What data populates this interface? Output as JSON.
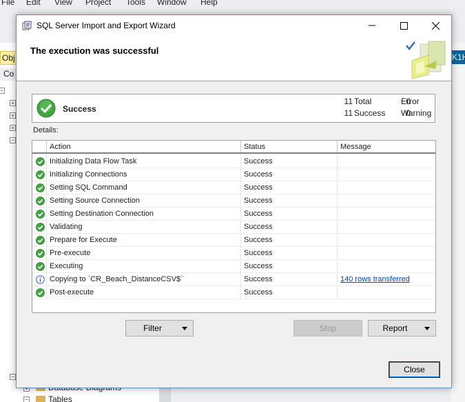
{
  "background": {
    "menu": [
      "File",
      "Edit",
      "View",
      "Project",
      "Tools",
      "Window",
      "Help"
    ],
    "object_tab": "Obj",
    "connect_label": "Co",
    "right_tab": "K1H",
    "tree_items": [
      "Database Diagrams",
      "Tables"
    ]
  },
  "window": {
    "title": "SQL Server Import and Export Wizard"
  },
  "header": {
    "title": "The execution was successful"
  },
  "summary": {
    "status": "Success",
    "total_count": "11",
    "total_label": "Total",
    "success_count": "11",
    "success_label": "Success",
    "error_count": "0",
    "error_label": "Error",
    "warning_count": "0",
    "warning_label": "Warning"
  },
  "details_label": "Details:",
  "grid": {
    "columns": [
      "Action",
      "Status",
      "Message"
    ],
    "rows": [
      {
        "icon": "success-icon",
        "action": "Initializing Data Flow Task",
        "status": "Success",
        "message": ""
      },
      {
        "icon": "success-icon",
        "action": "Initializing Connections",
        "status": "Success",
        "message": ""
      },
      {
        "icon": "success-icon",
        "action": "Setting SQL Command",
        "status": "Success",
        "message": ""
      },
      {
        "icon": "success-icon",
        "action": "Setting Source Connection",
        "status": "Success",
        "message": ""
      },
      {
        "icon": "success-icon",
        "action": "Setting Destination Connection",
        "status": "Success",
        "message": ""
      },
      {
        "icon": "success-icon",
        "action": "Validating",
        "status": "Success",
        "message": ""
      },
      {
        "icon": "success-icon",
        "action": "Prepare for Execute",
        "status": "Success",
        "message": ""
      },
      {
        "icon": "success-icon",
        "action": "Pre-execute",
        "status": "Success",
        "message": ""
      },
      {
        "icon": "success-icon",
        "action": "Executing",
        "status": "Success",
        "message": ""
      },
      {
        "icon": "info-icon",
        "action": "Copying to `CR_Beach_DistanceCSV$`",
        "status": "Success",
        "message": "140 rows transferred"
      },
      {
        "icon": "success-icon",
        "action": "Post-execute",
        "status": "Success",
        "message": ""
      }
    ]
  },
  "buttons": {
    "filter": "Filter",
    "stop": "Stop",
    "report": "Report",
    "close": "Close"
  },
  "colors": {
    "success_green": "#3fa63f",
    "info_blue": "#3a63b8",
    "link": "#0645ad",
    "focus_border": "#0078d7"
  }
}
